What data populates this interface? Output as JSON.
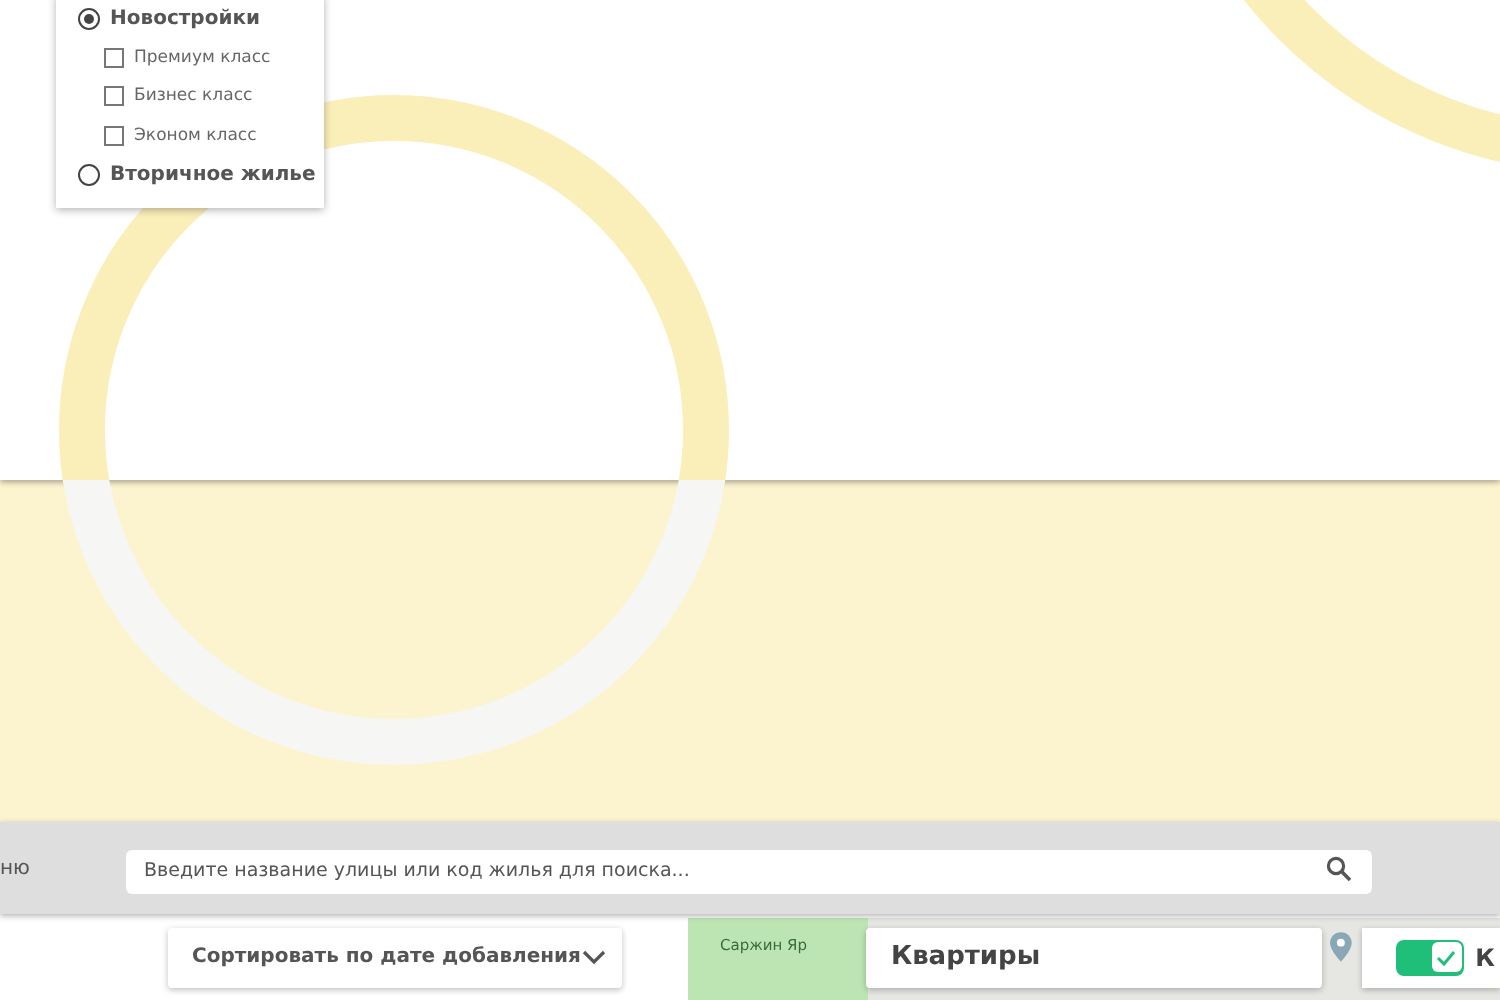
{
  "filter_menu": {
    "items": [
      {
        "kind": "radio",
        "label": "Новостройки",
        "selected": true
      },
      {
        "kind": "checkbox",
        "label": "Премиум класс",
        "checked": false
      },
      {
        "kind": "checkbox",
        "label": "Бизнес класс",
        "checked": false
      },
      {
        "kind": "checkbox",
        "label": "Эконом класс",
        "checked": false
      },
      {
        "kind": "radio",
        "label": "Вторичное жилье",
        "selected": false
      }
    ]
  },
  "toolbar": {
    "menu_label": "ню",
    "search": {
      "placeholder": "Введите название улицы или код жилья для поиска..."
    }
  },
  "results_bar": {
    "sort": {
      "value": "Сортировать по дате добавления"
    },
    "map": {
      "place_label": "Саржин Яр"
    },
    "category": {
      "value": "Квартиры"
    },
    "toggle": {
      "on": true,
      "label": "К"
    }
  }
}
